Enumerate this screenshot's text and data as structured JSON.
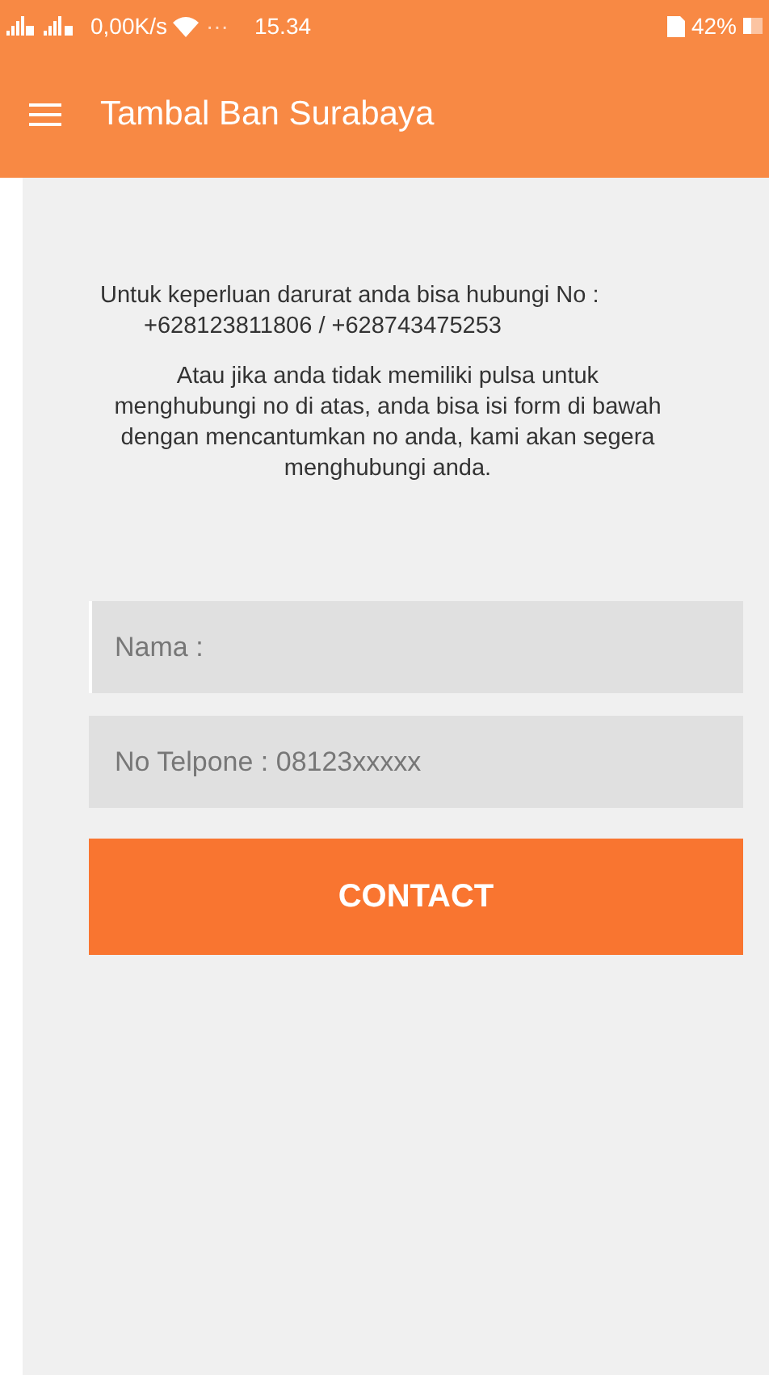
{
  "status_bar": {
    "speed": "0,00K/s",
    "dots": "···",
    "time": "15.34",
    "battery": "42%"
  },
  "app_bar": {
    "title": "Tambal Ban Surabaya"
  },
  "info": {
    "line_1": "Untuk keperluan darurat anda bisa hubungi No :",
    "line_2": "+628123811806 / +628743475253",
    "paragraph": "Atau jika anda tidak memiliki pulsa untuk menghubungi no di atas, anda bisa isi form di bawah dengan mencantumkan no anda, kami akan segera menghubungi anda."
  },
  "form": {
    "fields": [
      {
        "placeholder": "Nama :",
        "focused": true
      },
      {
        "placeholder": "No Telpone : 08123xxxxx",
        "focused": false
      }
    ],
    "button": "CONTACT"
  }
}
